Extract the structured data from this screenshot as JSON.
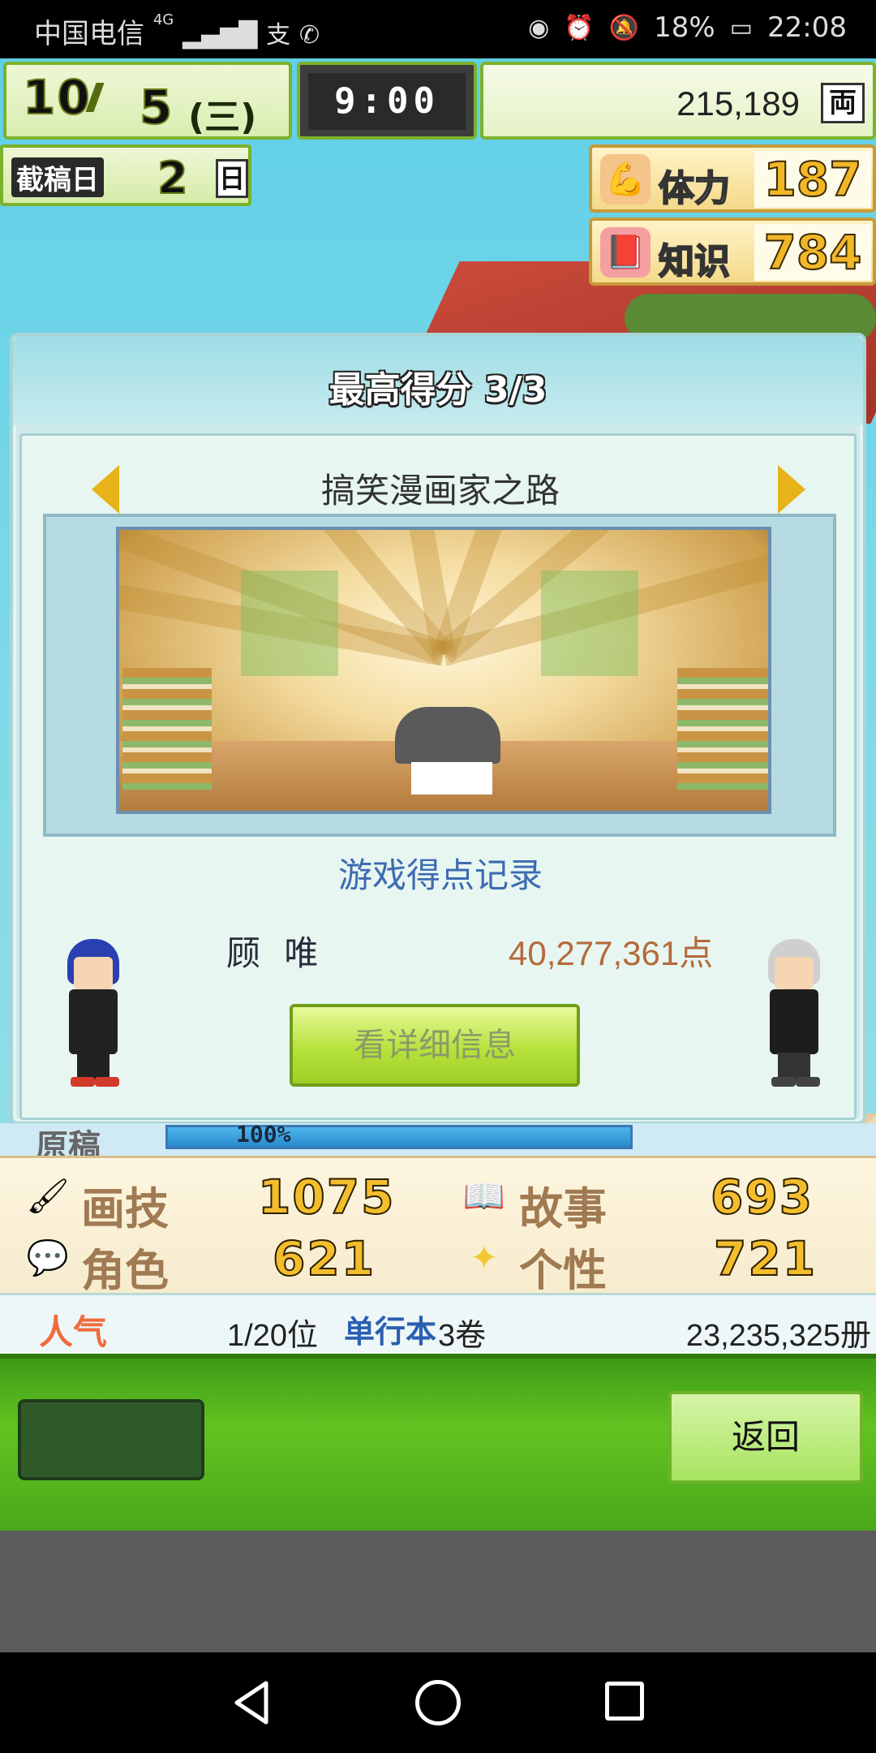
{
  "status_bar": {
    "carrier": "中国电信",
    "network": "4G",
    "battery": "18%",
    "time": "22:08"
  },
  "hud": {
    "month": "10",
    "day": "5",
    "weekday": "(三)",
    "clock": "9:00",
    "money": "215,189",
    "money_unit": "両",
    "deadline_label": "截稿日",
    "deadline_value": "2",
    "deadline_unit": "日",
    "stamina_label": "体力",
    "stamina_value": "187",
    "knowledge_label": "知识",
    "knowledge_value": "784"
  },
  "modal": {
    "title": "最高得分 3/3",
    "record_title": "搞笑漫画家之路",
    "score_caption": "游戏得点记录",
    "player_name": "顾 唯",
    "player_score": "40,277,361点",
    "detail_button": "看详细信息"
  },
  "progress": {
    "label": "原稿",
    "text": "100%",
    "value": 1.0
  },
  "stats": {
    "art_label": "画技",
    "art_value": "1075",
    "story_label": "故事",
    "story_value": "693",
    "character_label": "角色",
    "character_value": "621",
    "personality_label": "个性",
    "personality_value": "721"
  },
  "popularity": {
    "label": "人气",
    "rank": "1/20位",
    "volumes_label": "单行本",
    "volumes": "3卷",
    "sales": "23,235,325册"
  },
  "actions": {
    "back_label": "返回"
  },
  "colors": {
    "accent_green": "#61c420",
    "gold": "#f4bd2c",
    "score_text": "#b56a3a",
    "caption_blue": "#3d6ab1"
  },
  "icons": {
    "stamina": "muscle-icon",
    "knowledge": "book-icon",
    "art": "paintbrush-icon",
    "story": "open-book-icon",
    "character": "speech-face-icon",
    "personality": "sparkle-icon"
  }
}
